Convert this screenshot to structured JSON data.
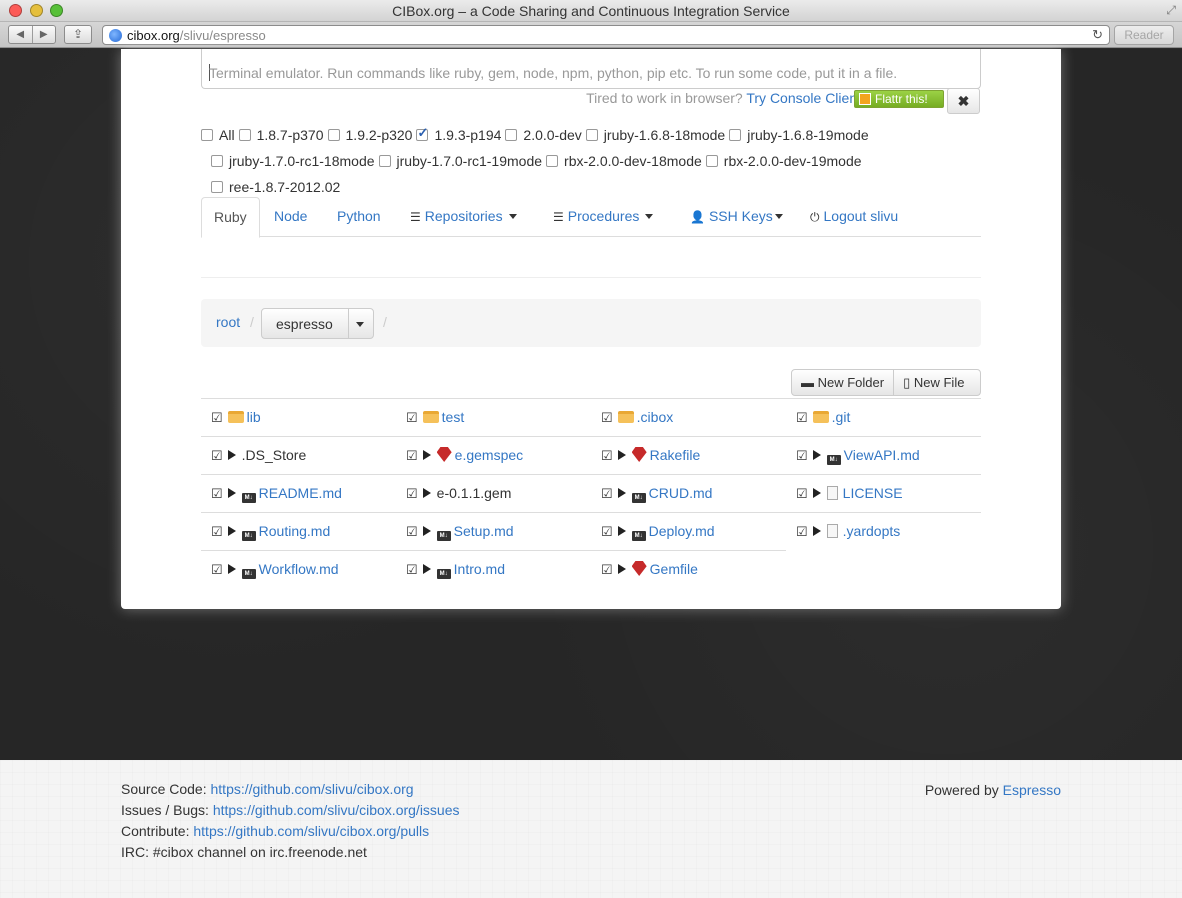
{
  "window": {
    "title": "CIBox.org – a Code Sharing and Continuous Integration Service"
  },
  "browser": {
    "url_host": "cibox.org",
    "url_path": "/slivu/espresso",
    "reader_label": "Reader"
  },
  "terminal": {
    "placeholder": "Terminal emulator. Run commands like ruby, gem, node, npm, python, pip etc. To run some code, put it in a file."
  },
  "console": {
    "prompt": "Tired to work in browser?",
    "link": "Try Console Client",
    "flattr": "Flattr this!"
  },
  "versions": {
    "row1": [
      {
        "label": "All",
        "checked": false
      },
      {
        "label": "1.8.7-p370",
        "checked": false
      },
      {
        "label": "1.9.2-p320",
        "checked": false
      },
      {
        "label": "1.9.3-p194",
        "checked": true
      },
      {
        "label": "2.0.0-dev",
        "checked": false
      },
      {
        "label": "jruby-1.6.8-18mode",
        "checked": false
      },
      {
        "label": "jruby-1.6.8-19mode",
        "checked": false
      }
    ],
    "row2": [
      {
        "label": "jruby-1.7.0-rc1-18mode",
        "checked": false
      },
      {
        "label": "jruby-1.7.0-rc1-19mode",
        "checked": false
      },
      {
        "label": "rbx-2.0.0-dev-18mode",
        "checked": false
      },
      {
        "label": "rbx-2.0.0-dev-19mode",
        "checked": false
      }
    ],
    "row3": [
      {
        "label": "ree-1.8.7-2012.02",
        "checked": false
      }
    ]
  },
  "tabs": {
    "ruby": "Ruby",
    "node": "Node",
    "python": "Python",
    "repositories": "Repositories",
    "procedures": "Procedures",
    "ssh_keys": "SSH Keys",
    "logout": "Logout slivu"
  },
  "breadcrumb": {
    "root": "root",
    "sep": "/",
    "current": "espresso"
  },
  "file_actions": {
    "new_folder": "New Folder",
    "new_file": "New File"
  },
  "files": [
    [
      {
        "name": "lib",
        "icon": "folder-icon",
        "play": false,
        "link": true
      },
      {
        "name": "test",
        "icon": "folder-icon",
        "play": false,
        "link": true
      },
      {
        "name": ".cibox",
        "icon": "folder-icon",
        "play": false,
        "link": true
      },
      {
        "name": ".git",
        "icon": "folder-icon",
        "play": false,
        "link": true
      }
    ],
    [
      {
        "name": ".DS_Store",
        "icon": "",
        "play": true,
        "link": false
      },
      {
        "name": "e.gemspec",
        "icon": "ruby-icon",
        "play": true,
        "link": true
      },
      {
        "name": "Rakefile",
        "icon": "ruby-icon",
        "play": true,
        "link": true
      },
      {
        "name": "ViewAPI.md",
        "icon": "markdown-icon",
        "play": true,
        "link": true
      }
    ],
    [
      {
        "name": "README.md",
        "icon": "markdown-icon",
        "play": true,
        "link": true
      },
      {
        "name": "e-0.1.1.gem",
        "icon": "",
        "play": true,
        "link": false
      },
      {
        "name": "CRUD.md",
        "icon": "markdown-icon",
        "play": true,
        "link": true
      },
      {
        "name": "LICENSE",
        "icon": "document-icon",
        "play": true,
        "link": true
      }
    ],
    [
      {
        "name": "Routing.md",
        "icon": "markdown-icon",
        "play": true,
        "link": true
      },
      {
        "name": "Setup.md",
        "icon": "markdown-icon",
        "play": true,
        "link": true
      },
      {
        "name": "Deploy.md",
        "icon": "markdown-icon",
        "play": true,
        "link": true
      },
      {
        "name": ".yardopts",
        "icon": "document-icon",
        "play": true,
        "link": true
      }
    ],
    [
      {
        "name": "Workflow.md",
        "icon": "markdown-icon",
        "play": true,
        "link": true
      },
      {
        "name": "Intro.md",
        "icon": "markdown-icon",
        "play": true,
        "link": true
      },
      {
        "name": "Gemfile",
        "icon": "ruby-icon",
        "play": true,
        "link": true
      }
    ]
  ],
  "footer": {
    "source_label": "Source Code:",
    "source_url": "https://github.com/slivu/cibox.org",
    "issues_label": "Issues / Bugs:",
    "issues_url": "https://github.com/slivu/cibox.org/issues",
    "contribute_label": "Contribute:",
    "contribute_url": "https://github.com/slivu/cibox.org/pulls",
    "irc": "IRC: #cibox channel on irc.freenode.net",
    "powered_label": "Powered by",
    "powered_link": "Espresso"
  }
}
